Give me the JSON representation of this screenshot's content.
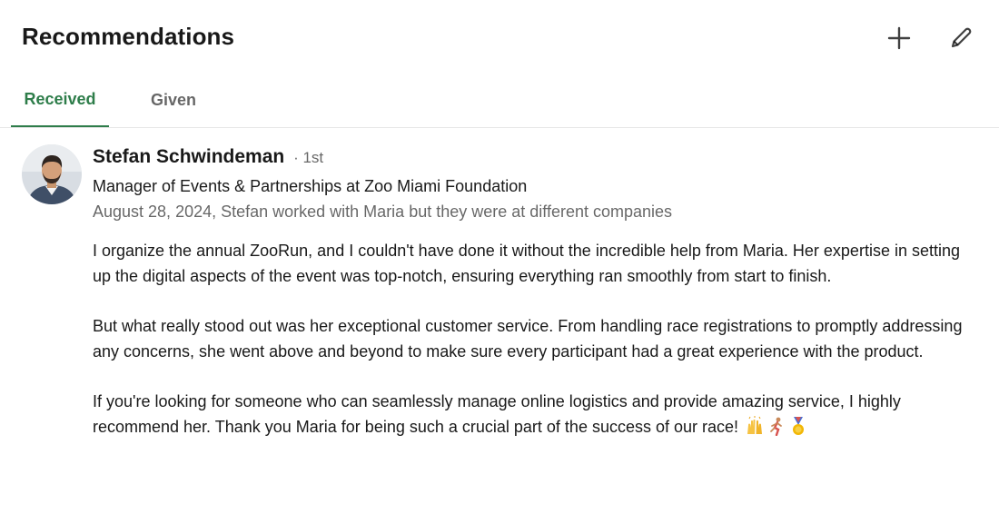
{
  "header": {
    "title": "Recommendations"
  },
  "icons": {
    "add": "plus-icon",
    "edit": "pencil-icon"
  },
  "tabs": [
    {
      "label": "Received",
      "active": true
    },
    {
      "label": "Given",
      "active": false
    }
  ],
  "colors": {
    "accent_green": "#2e7d4a",
    "text_primary": "rgba(0,0,0,0.9)",
    "text_secondary": "rgba(0,0,0,0.6)"
  },
  "recommendation": {
    "name": "Stefan Schwindeman",
    "degree": "· 1st",
    "headline": "Manager of Events & Partnerships at Zoo Miami Foundation",
    "meta": "August 28, 2024, Stefan worked with Maria but they were at different companies",
    "paragraphs": [
      "I organize the annual ZooRun, and I couldn't have done it without the incredible help from Maria. Her expertise in setting up the digital aspects of the event was top-notch, ensuring everything ran smoothly from start to finish.",
      "But what really stood out was her exceptional customer service. From handling race registrations to promptly addressing any concerns, she went above and beyond to make sure every participant had a great experience with the product.",
      "If you're looking for someone who can seamlessly manage online logistics and provide amazing service, I highly recommend her. Thank you Maria for being such a crucial part of the success of our race!"
    ],
    "emojis": [
      "raising-hands-icon",
      "runner-icon",
      "medal-icon"
    ]
  }
}
